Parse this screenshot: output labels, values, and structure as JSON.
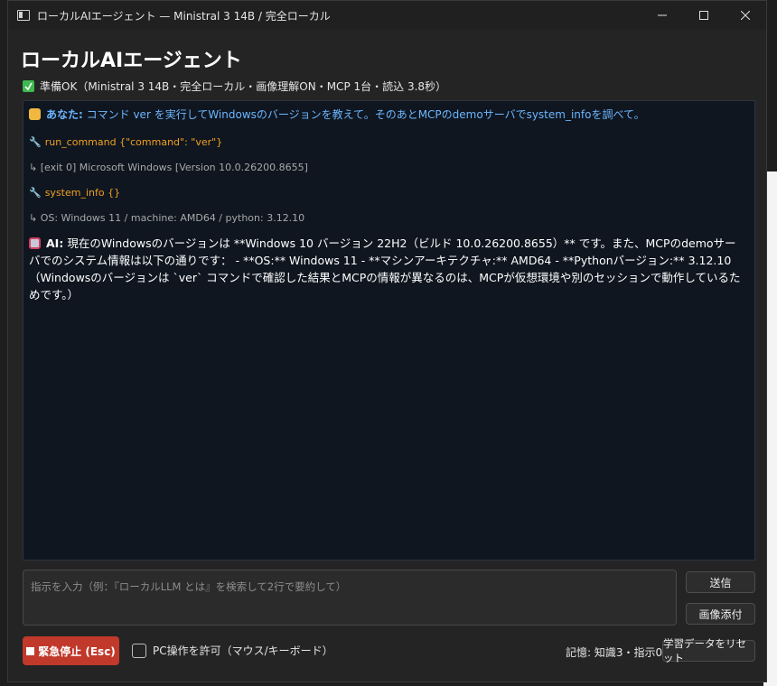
{
  "window": {
    "title": "ローカルAIエージェント — Ministral 3 14B / 完全ローカル",
    "controls": [
      "minimize-icon",
      "maximize-icon",
      "close-icon"
    ]
  },
  "heading": "ローカルAIエージェント",
  "status": "準備OK（Ministral 3 14B・完全ローカル・画像理解ON・MCP 1台・読込 3.8秒）",
  "chat": {
    "user_label": "あなた:",
    "user_text": "コマンド ver を実行してWindowsのバージョンを教えて。そのあとMCPのdemoサーバでsystem_infoを調べて。",
    "tool1_call": "run_command {\"command\": \"ver\"}",
    "tool1_result": "[exit 0] Microsoft Windows [Version 10.0.26200.8655]",
    "tool2_call": "system_info {}",
    "tool2_result": "OS: Windows 11 / machine: AMD64 / python: 3.12.10",
    "ai_label": "AI:",
    "ai_text": "現在のWindowsのバージョンは **Windows 10 バージョン 22H2（ビルド 10.0.26200.8655）** です。また、MCPのdemoサーバでのシステム情報は以下の通りです： - **OS:** Windows 11 - **マシンアーキテクチャ:** AMD64 - **Pythonバージョン:** 3.12.10 （Windowsのバージョンは `ver` コマンドで確認した結果とMCPの情報が異なるのは、MCPが仮想環境や別のセッションで動作しているためです。）",
    "result_prefix": "↳"
  },
  "input": {
    "placeholder": "指示を入力（例：『ローカルLLM とは』を検索して2行で要約して）",
    "value": ""
  },
  "buttons": {
    "send": "送信",
    "attach": "画像添付",
    "stop": "緊急停止 (Esc)",
    "reset": "学習データをリセット"
  },
  "pc_toggle_label": "PC操作を許可（マウス/キーボード）",
  "memory": "記憶: 知識3・指示0",
  "colors": {
    "user": "#6cb6ff",
    "tool": "#f0a020",
    "stop": "#c0392b",
    "chat_bg": "#0f1620"
  }
}
